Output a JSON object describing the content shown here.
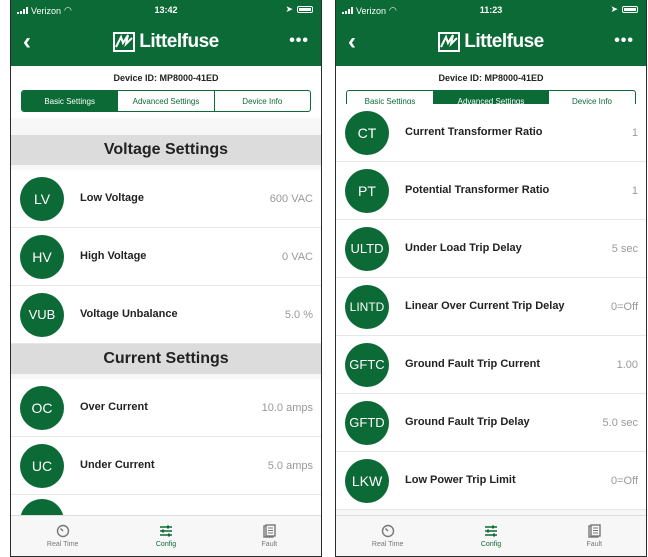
{
  "status_left": {
    "carrier": "Verizon",
    "time": "13:42"
  },
  "status_right": {
    "carrier": "Verizon",
    "time": "11:23"
  },
  "app": {
    "logo_text": "Littelfuse",
    "more": "•••",
    "back": "‹"
  },
  "device_id": "Device ID: MP8000-41ED",
  "tabs": [
    {
      "label": "Basic Settings"
    },
    {
      "label": "Advanced Settings"
    },
    {
      "label": "Device Info"
    }
  ],
  "left_screen": {
    "voltage_header": "Voltage Settings",
    "voltage_rows": [
      {
        "badge": "LV",
        "label": "Low Voltage",
        "value": "600 VAC"
      },
      {
        "badge": "HV",
        "label": "High Voltage",
        "value": "0 VAC"
      },
      {
        "badge": "VUB",
        "label": "Voltage Unbalance",
        "value": "5.0 %"
      }
    ],
    "current_header": "Current Settings",
    "current_rows": [
      {
        "badge": "OC",
        "label": "Over Current",
        "value": "10.0 amps"
      },
      {
        "badge": "UC",
        "label": "Under Current",
        "value": "5.0 amps"
      }
    ]
  },
  "right_screen": {
    "rows": [
      {
        "badge": "CT",
        "label": "Current Transformer Ratio",
        "value": "1"
      },
      {
        "badge": "PT",
        "label": "Potential Transformer Ratio",
        "value": "1"
      },
      {
        "badge": "ULTD",
        "label": "Under Load Trip Delay",
        "value": "5 sec"
      },
      {
        "badge": "LINTD",
        "label": "Linear Over Current Trip Delay",
        "value": "0=Off"
      },
      {
        "badge": "GFTC",
        "label": "Ground Fault Trip Current",
        "value": "1.00"
      },
      {
        "badge": "GFTD",
        "label": "Ground Fault Trip Delay",
        "value": "5.0 sec"
      },
      {
        "badge": "LKW",
        "label": "Low Power Trip Limit",
        "value": "0=Off"
      }
    ]
  },
  "tab_bar": [
    {
      "label": "Real Time",
      "icon": "gauge-icon"
    },
    {
      "label": "Config",
      "icon": "sliders-icon"
    },
    {
      "label": "Fault",
      "icon": "document-icon"
    }
  ],
  "colors": {
    "brand_green": "#0b6a35",
    "section_gray": "#dcdcdc"
  }
}
